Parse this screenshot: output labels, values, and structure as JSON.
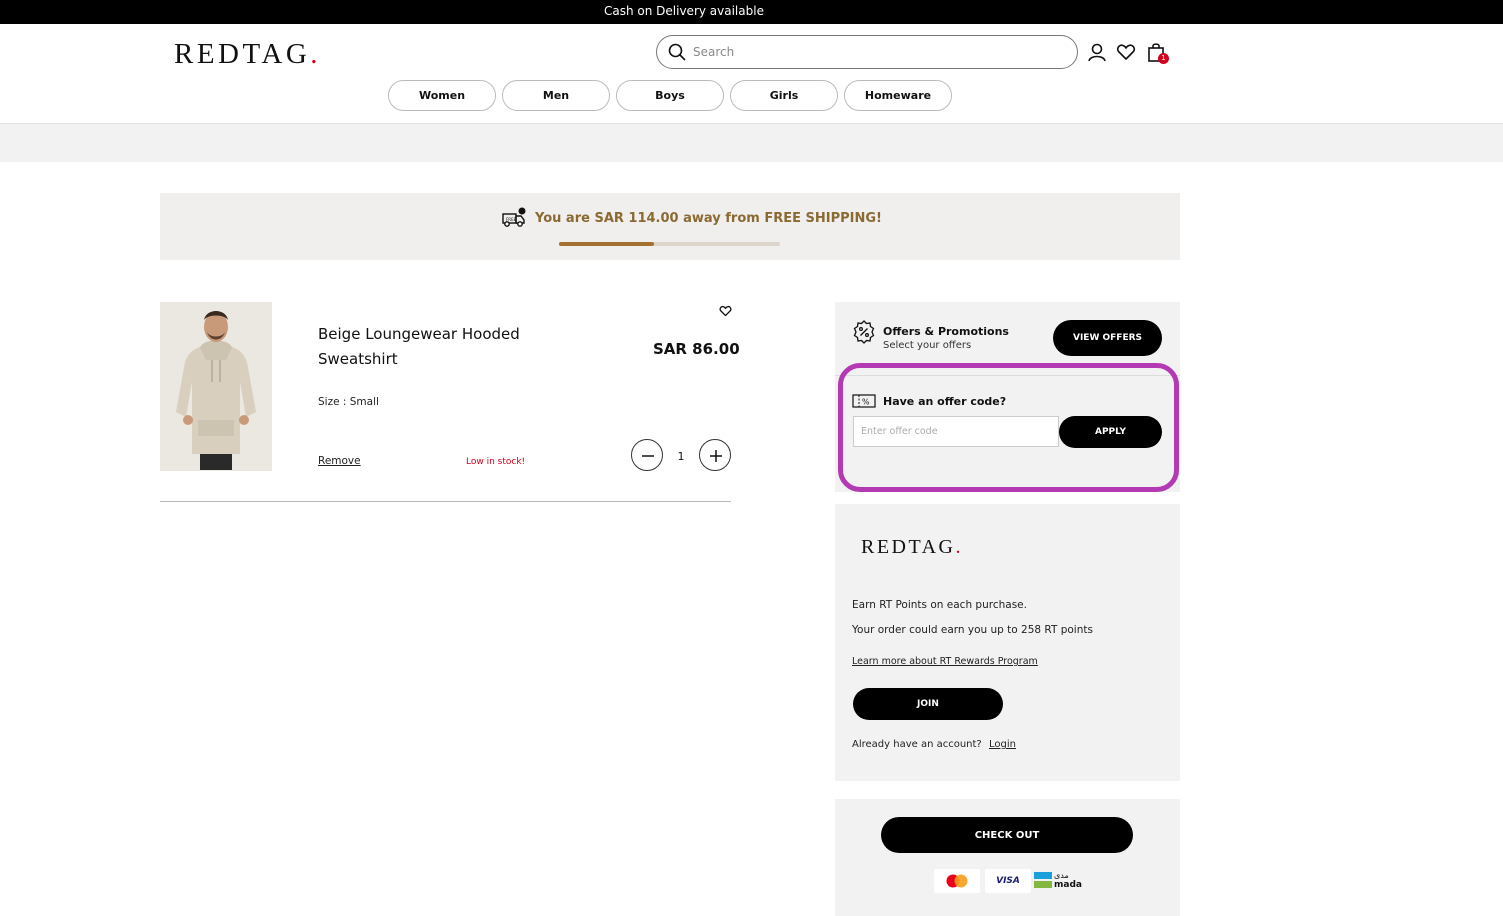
{
  "topbar": {
    "message": "Cash on Delivery available"
  },
  "header": {
    "logo_text": "REDTAG",
    "logo_dot": ".",
    "search_placeholder": "Search",
    "cart_count": "1",
    "icons": [
      "search-icon",
      "user-icon",
      "heart-icon",
      "bag-icon"
    ]
  },
  "nav": {
    "items": [
      {
        "label": "Women"
      },
      {
        "label": "Men"
      },
      {
        "label": "Boys"
      },
      {
        "label": "Girls"
      },
      {
        "label": "Homeware"
      }
    ]
  },
  "shipping": {
    "message": "You are SAR 114.00 away from FREE SHIPPING!",
    "progress_percent": 43,
    "accent_color": "#a47130"
  },
  "cart": {
    "item": {
      "name": "Beige Loungewear Hooded Sweatshirt",
      "size": "Size : Small",
      "price": "SAR 86.00",
      "remove_label": "Remove",
      "stock_label": "Low in stock!",
      "quantity": "1"
    }
  },
  "offers": {
    "title": "Offers & Promotions",
    "subtitle": "Select your offers",
    "view_button": "VIEW OFFERS",
    "code_label": "Have an offer code?",
    "code_placeholder": "Enter offer code",
    "apply_button": "APPLY",
    "highlight_color": "#b43ab4"
  },
  "rewards": {
    "logo_text": "REDTAG",
    "logo_dot": ".",
    "line1": "Earn RT Points on each purchase.",
    "line2": "Your order could earn you up to 258 RT points",
    "learn_link": "Learn more about RT Rewards Program",
    "join_button": "JOIN",
    "already_text": "Already have an account?",
    "login_link": "Login"
  },
  "checkout": {
    "button": "CHECK OUT",
    "payment_methods": [
      "mastercard",
      "VISA",
      "mada"
    ],
    "mada_arabic": "مدى"
  },
  "colors": {
    "brand_red": "#d4001e",
    "black": "#000000"
  }
}
